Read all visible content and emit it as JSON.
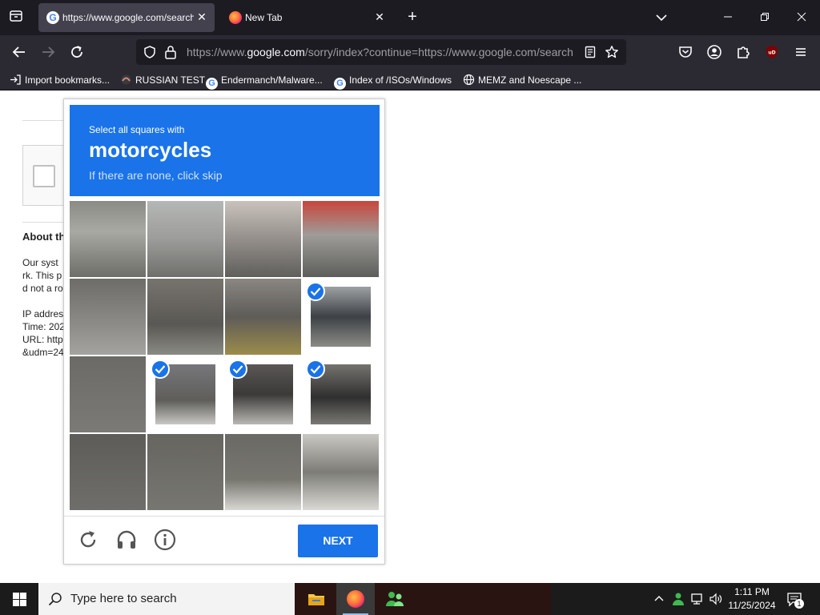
{
  "browser": {
    "tabs": [
      {
        "title": "https://www.google.com/search",
        "active": true,
        "favicon": "google-icon"
      },
      {
        "title": "New Tab",
        "active": false,
        "favicon": "firefox-icon"
      }
    ],
    "url": {
      "prefix": "https://www.",
      "domain": "google.com",
      "rest": "/sorry/index?continue=https://www.google.com/search"
    },
    "bookmarks": [
      {
        "label": "Import bookmarks...",
        "icon": "import-icon"
      },
      {
        "label": "RUSSIAN TEST",
        "icon": "bookmark-site-icon"
      },
      {
        "label": "Endermanch/Malware...",
        "icon": "google-icon"
      },
      {
        "label": "Index of /ISOs/Windows",
        "icon": "google-icon"
      },
      {
        "label": "MEMZ and Noescape ...",
        "icon": "globe-icon"
      }
    ]
  },
  "page": {
    "heading_partial": "About th",
    "para_lines": [
      "Our syst",
      "rk. This p",
      "d not a ro"
    ],
    "ip_label": "IP addres",
    "time_label": "Time: 202",
    "url_label": "URL: http",
    "udm_label": "&udm=24"
  },
  "captcha": {
    "instruction": "Select all squares with",
    "target": "motorcycles",
    "hint": "If there are none, click skip",
    "selected_tiles": [
      7,
      9,
      10,
      11
    ],
    "next_label": "NEXT",
    "colors": {
      "accent": "#1a73e8"
    }
  },
  "taskbar": {
    "search_placeholder": "Type here to search",
    "time": "1:11 PM",
    "date": "11/25/2024",
    "notification_count": "1"
  }
}
